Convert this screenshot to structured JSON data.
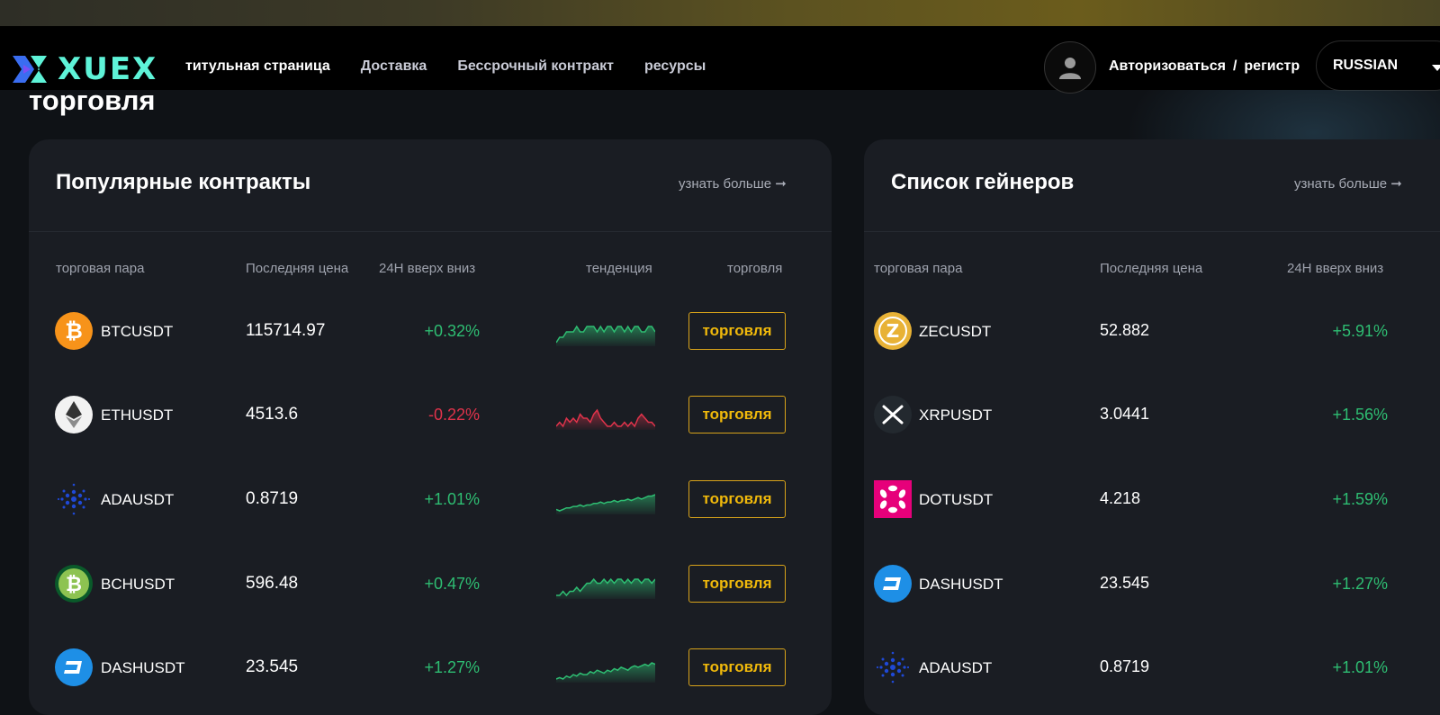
{
  "header": {
    "logo_text": "XUEX",
    "nav": [
      "титульная страница",
      "Доставка",
      "Бессрочный контракт",
      "ресурсы"
    ],
    "login_label": "Авторизоваться",
    "separator": "/",
    "register_label": "регистр",
    "language": "RUSSIAN"
  },
  "page_title": "торговля",
  "popular": {
    "title": "Популярные контракты",
    "more_label": "узнать больше",
    "columns": [
      "торговая пара",
      "Последняя цена",
      "24H вверх вниз",
      "тенденция",
      "торговля"
    ],
    "trade_label": "торговля",
    "rows": [
      {
        "symbol": "BTCUSDT",
        "price": "115714.97",
        "change": "+0.32%",
        "icon": "bitcoin-icon",
        "color": "#f7931a",
        "trend": [
          4,
          5,
          5,
          6,
          6,
          6,
          7,
          6,
          6,
          7,
          7,
          7,
          6,
          7,
          6,
          7,
          7,
          6,
          7,
          7,
          6,
          7,
          6,
          7,
          7,
          6,
          6,
          7,
          7,
          6
        ],
        "dir": "up"
      },
      {
        "symbol": "ETHUSDT",
        "price": "4513.6",
        "change": "-0.22%",
        "icon": "ethereum-icon",
        "color": "#f2f2f2",
        "trend": [
          6,
          7,
          6,
          8,
          7,
          8,
          7,
          9,
          8,
          8,
          7,
          9,
          10,
          8,
          7,
          6,
          6,
          7,
          6,
          6,
          7,
          6,
          7,
          6,
          8,
          9,
          8,
          7,
          7,
          6
        ],
        "dir": "down"
      },
      {
        "symbol": "ADAUSDT",
        "price": "0.8719",
        "change": "+1.01%",
        "icon": "cardano-icon",
        "color": "#1f49d6",
        "trend": [
          3,
          2,
          3,
          4,
          4,
          5,
          5,
          6,
          5,
          6,
          6,
          7,
          7,
          8,
          7,
          8,
          8,
          9,
          8,
          9,
          9,
          10,
          9,
          10,
          11,
          10,
          11,
          12,
          12,
          13
        ],
        "dir": "up"
      },
      {
        "symbol": "BCHUSDT",
        "price": "596.48",
        "change": "+0.47%",
        "icon": "bitcoin-cash-icon",
        "color": "#8dc351",
        "trend": [
          5,
          5,
          6,
          5,
          6,
          6,
          7,
          6,
          7,
          8,
          8,
          9,
          8,
          8,
          9,
          8,
          9,
          8,
          9,
          9,
          8,
          9,
          8,
          9,
          9,
          8,
          9,
          9,
          8,
          9
        ],
        "dir": "up"
      },
      {
        "symbol": "DASHUSDT",
        "price": "23.545",
        "change": "+1.27%",
        "icon": "dash-icon",
        "color": "#1e8fe6",
        "trend": [
          3,
          4,
          3,
          5,
          4,
          6,
          5,
          7,
          6,
          6,
          8,
          7,
          9,
          8,
          7,
          9,
          8,
          10,
          9,
          11,
          10,
          9,
          11,
          12,
          11,
          12,
          13,
          12,
          14,
          13
        ],
        "dir": "up"
      }
    ]
  },
  "gainers": {
    "title": "Список гейнеров",
    "more_label": "узнать больше",
    "columns": [
      "торговая пара",
      "Последняя цена",
      "24H вверх вниз"
    ],
    "rows": [
      {
        "symbol": "ZECUSDT",
        "price": "52.882",
        "change": "+5.91%",
        "icon": "zcash-icon",
        "color": "#e8b236"
      },
      {
        "symbol": "XRPUSDT",
        "price": "3.0441",
        "change": "+1.56%",
        "icon": "xrp-icon",
        "color": "#23292f"
      },
      {
        "symbol": "DOTUSDT",
        "price": "4.218",
        "change": "+1.59%",
        "icon": "polkadot-icon",
        "color": "#e6007a"
      },
      {
        "symbol": "DASHUSDT",
        "price": "23.545",
        "change": "+1.27%",
        "icon": "dash-icon",
        "color": "#1e8fe6"
      },
      {
        "symbol": "ADAUSDT",
        "price": "0.8719",
        "change": "+1.01%",
        "icon": "cardano-icon",
        "color": "#1f49d6"
      }
    ]
  },
  "colors": {
    "up": "#2ebd72",
    "down": "#e0334b",
    "accent": "#f0b90b",
    "logo": "#5ef3d8"
  }
}
